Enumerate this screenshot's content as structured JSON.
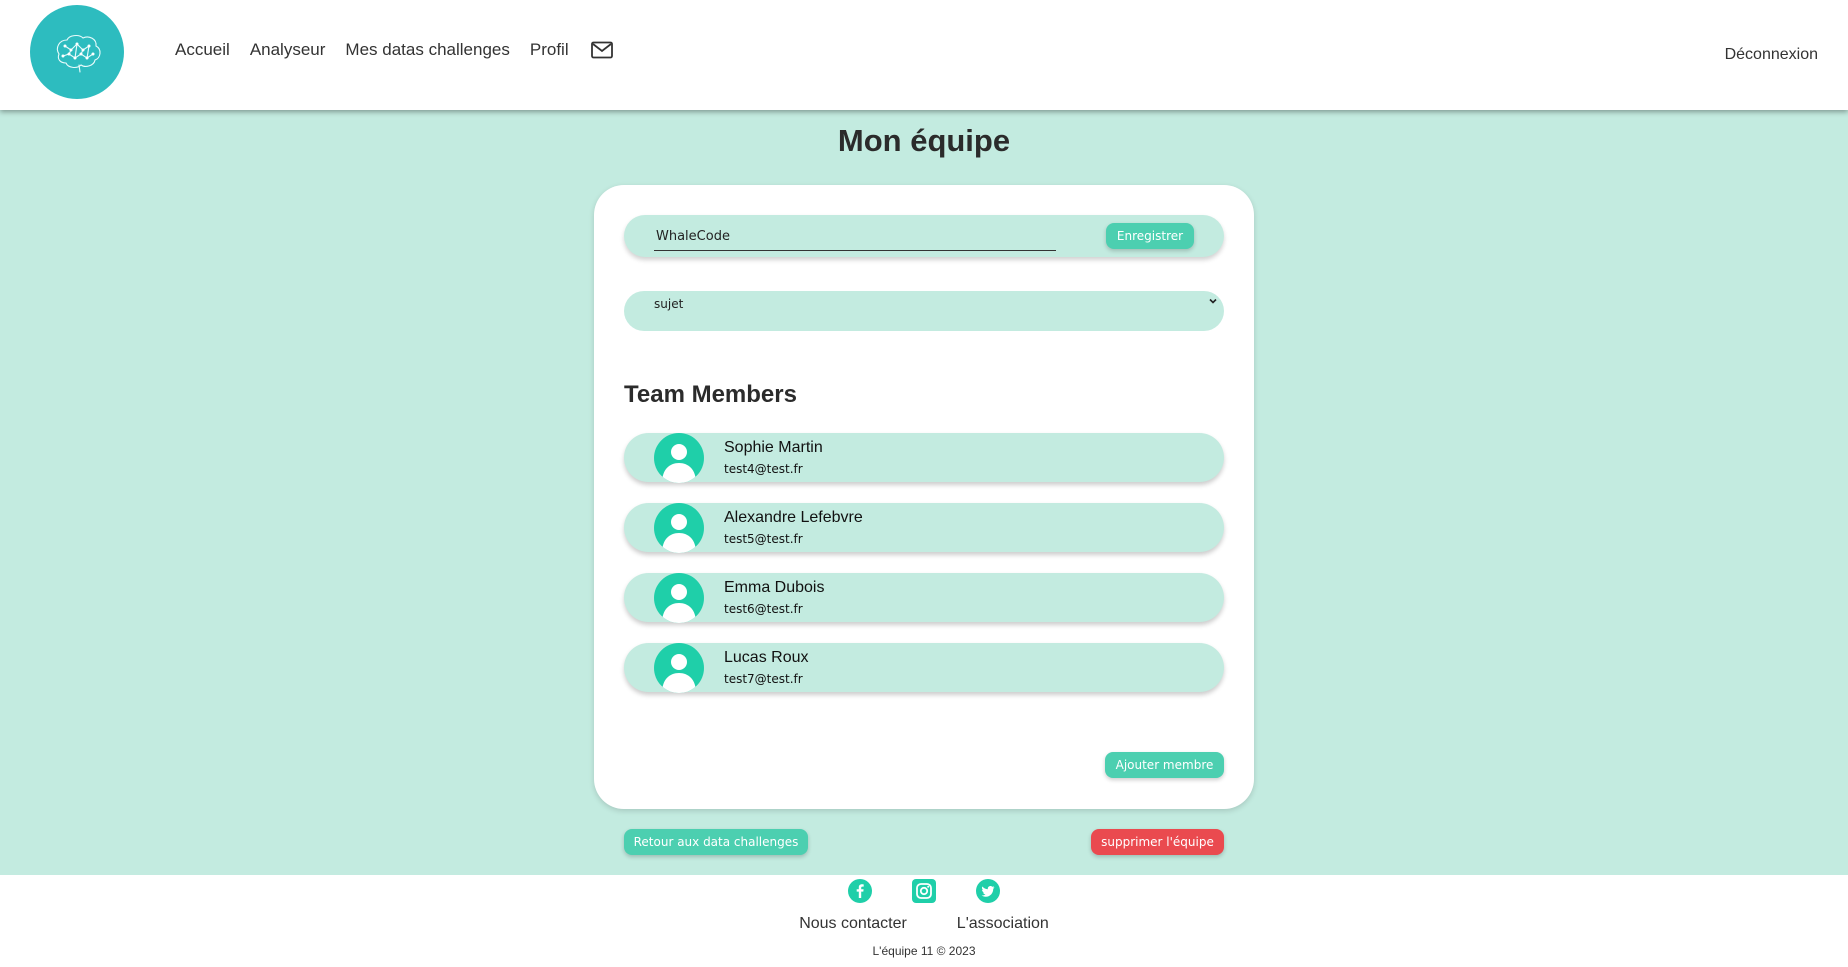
{
  "header": {
    "nav": [
      "Accueil",
      "Analyseur",
      "Mes datas challenges",
      "Profil"
    ],
    "logout": "Déconnexion",
    "icons": {
      "logo": "brain-logo",
      "mail": "mail-icon"
    }
  },
  "page": {
    "title": "Mon équipe"
  },
  "team": {
    "name_value": "WhaleCode",
    "save_label": "Enregistrer",
    "subject_value": "sujet"
  },
  "members": {
    "title": "Team Members",
    "items": [
      {
        "name": "Sophie Martin",
        "email": "test4@test.fr"
      },
      {
        "name": "Alexandre Lefebvre",
        "email": "test5@test.fr"
      },
      {
        "name": "Emma Dubois",
        "email": "test6@test.fr"
      },
      {
        "name": "Lucas Roux",
        "email": "test7@test.fr"
      }
    ],
    "add_label": "Ajouter membre"
  },
  "actions": {
    "back_label": "Retour aux data challenges",
    "delete_label": "supprimer l'équipe"
  },
  "footer": {
    "links": [
      "Nous contacter",
      "L'association"
    ],
    "copyright": "L'équipe 11 © 2023",
    "socials": [
      "facebook-icon",
      "instagram-icon",
      "twitter-icon"
    ]
  },
  "colors": {
    "accent": "#4ccfb0",
    "teal": "#1fcfa9",
    "background": "#c3ebe0",
    "danger": "#ea4a4f",
    "logo": "#2dbcbf"
  }
}
